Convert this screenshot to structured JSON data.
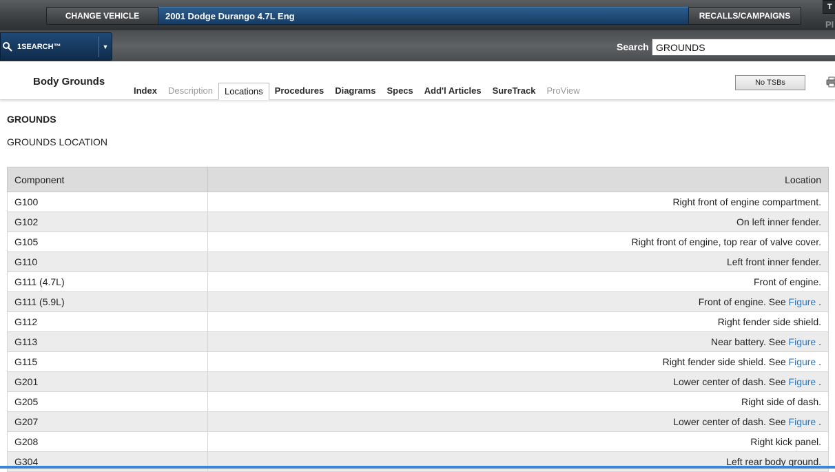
{
  "topbar": {
    "change_vehicle": "CHANGE VEHICLE",
    "vehicle": "2001 Dodge Durango 4.7L Eng",
    "recalls": "RECALLS/CAMPAIGNS",
    "corner_box": "T",
    "corner_text": "PI"
  },
  "searchbar": {
    "onesearch_label": "1SEARCH™",
    "search_label": "Search",
    "search_value": "GROUNDS"
  },
  "section": {
    "title": "Body Grounds",
    "tabs": [
      {
        "label": "Index",
        "state": "normal"
      },
      {
        "label": "Description",
        "state": "disabled"
      },
      {
        "label": "Locations",
        "state": "active"
      },
      {
        "label": "Procedures",
        "state": "normal"
      },
      {
        "label": "Diagrams",
        "state": "normal"
      },
      {
        "label": "Specs",
        "state": "normal"
      },
      {
        "label": "Add'l Articles",
        "state": "normal"
      },
      {
        "label": "SureTrack",
        "state": "normal"
      },
      {
        "label": "ProView",
        "state": "disabled"
      }
    ],
    "no_tsbs": "No TSBs"
  },
  "content": {
    "heading": "GROUNDS",
    "subheading": "GROUNDS LOCATION",
    "table": {
      "columns": [
        "Component",
        "Location"
      ],
      "link_text": "Figure",
      "rows": [
        {
          "component": "G100",
          "location": "Right front of engine compartment.",
          "link": false
        },
        {
          "component": "G102",
          "location": "On left inner fender.",
          "link": false
        },
        {
          "component": "G105",
          "location": "Right front of engine, top rear of valve cover.",
          "link": false
        },
        {
          "component": "G110",
          "location": "Left front inner fender.",
          "link": false
        },
        {
          "component": "G111 (4.7L)",
          "location": "Front of engine.",
          "link": false
        },
        {
          "component": "G111 (5.9L)",
          "location": "Front of engine. See ",
          "link": true
        },
        {
          "component": "G112",
          "location": "Right fender side shield.",
          "link": false
        },
        {
          "component": "G113",
          "location": "Near battery. See ",
          "link": true
        },
        {
          "component": "G115",
          "location": "Right fender side shield. See ",
          "link": true
        },
        {
          "component": "G201",
          "location": "Lower center of dash. See ",
          "link": true
        },
        {
          "component": "G205",
          "location": "Right side of dash.",
          "link": false
        },
        {
          "component": "G207",
          "location": "Lower center of dash. See ",
          "link": true
        },
        {
          "component": "G208",
          "location": "Right kick panel.",
          "link": false
        },
        {
          "component": "G304",
          "location": "Left rear body ground.",
          "link": false
        }
      ]
    }
  },
  "colors": {
    "vehicle_bar": "#1f4a76",
    "link": "#2f75b8",
    "row_alt": "#ececec"
  },
  "icons": {
    "search": "magnifier-icon",
    "dropdown": "caret-down-icon",
    "print": "printer-icon"
  }
}
